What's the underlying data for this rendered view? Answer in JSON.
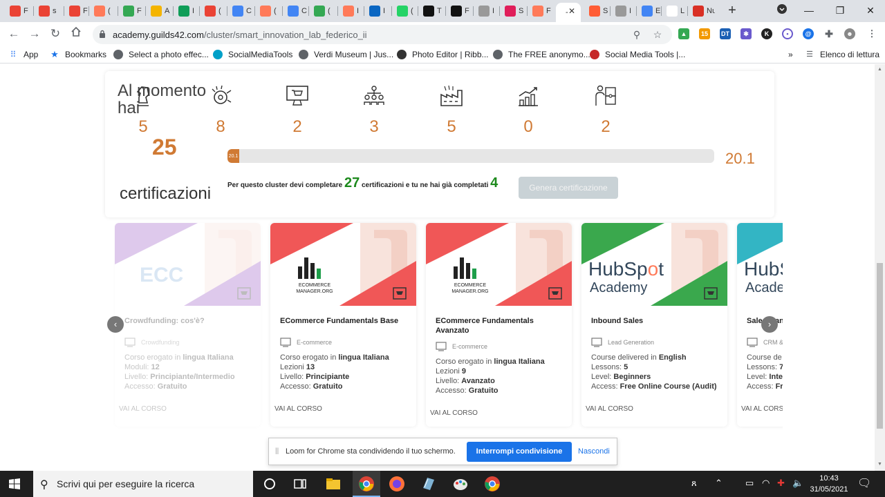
{
  "browser": {
    "tabs": [
      {
        "label": "F",
        "icon": "gmail-icon",
        "color": "#ea4335"
      },
      {
        "label": "s",
        "icon": "gmail-icon",
        "color": "#ea4335"
      },
      {
        "label": "F",
        "icon": "gmail-icon",
        "color": "#ea4335"
      },
      {
        "label": "(",
        "icon": "hubspot-icon",
        "color": "#ff7a59"
      },
      {
        "label": "F",
        "icon": "drive-icon",
        "color": "#34a853"
      },
      {
        "label": "A",
        "icon": "slides-icon",
        "color": "#f4b400"
      },
      {
        "label": "I",
        "icon": "sheets-icon",
        "color": "#0f9d58"
      },
      {
        "label": "(",
        "icon": "gmail-icon",
        "color": "#ea4335"
      },
      {
        "label": "C",
        "icon": "calendar-icon",
        "color": "#4285f4"
      },
      {
        "label": "(",
        "icon": "hubspot-icon",
        "color": "#ff7a59"
      },
      {
        "label": "C",
        "icon": "calendar-icon",
        "color": "#4285f4"
      },
      {
        "label": "(",
        "icon": "drive-icon",
        "color": "#34a853"
      },
      {
        "label": "I",
        "icon": "hubspot-icon",
        "color": "#ff7a59"
      },
      {
        "label": "I",
        "icon": "linkedin-icon",
        "color": "#0a66c2"
      },
      {
        "label": "(",
        "icon": "whatsapp-icon",
        "color": "#25d366"
      },
      {
        "label": "T",
        "icon": "circle-icon",
        "color": "#111111"
      },
      {
        "label": "F",
        "icon": "circle-icon",
        "color": "#111111"
      },
      {
        "label": "I",
        "icon": "dbox-icon",
        "color": "#999999"
      },
      {
        "label": "S",
        "icon": "slack-icon",
        "color": "#e01e5a"
      },
      {
        "label": "F",
        "icon": "hubspot-icon",
        "color": "#ff7a59"
      },
      {
        "label": "-",
        "icon": "page-icon",
        "color": "#ffffff",
        "active": true
      },
      {
        "label": "S",
        "icon": "hubspot-icon",
        "color": "#ff5c35"
      },
      {
        "label": "I",
        "icon": "dbox-icon",
        "color": "#999999"
      },
      {
        "label": "E",
        "icon": "chrome-app-icon",
        "color": "#4285f4"
      },
      {
        "label": "L",
        "icon": "page-icon",
        "color": "#ffffff"
      },
      {
        "label": "Nuo",
        "icon": "record-icon",
        "color": "#d93025"
      }
    ],
    "url_host": "academy.guilds42.com",
    "url_path": "/cluster/smart_innovation_lab_federico_ii",
    "bookmarks": [
      {
        "label": "App",
        "icon": "apps-grid-icon",
        "color": "#4285f4"
      },
      {
        "label": "Bookmarks",
        "icon": "star-icon",
        "color": "#1a73e8"
      },
      {
        "label": "Select a photo effec...",
        "icon": "globe-icon",
        "color": "#5f6368"
      },
      {
        "label": "SocialMediaTools",
        "icon": "m-logo-icon",
        "color": "#00a0c8"
      },
      {
        "label": "Verdi Museum | Jus...",
        "icon": "globe-icon",
        "color": "#5f6368"
      },
      {
        "label": "Photo Editor | Ribb...",
        "icon": "ribbet-icon",
        "color": "#333333"
      },
      {
        "label": "The FREE anonymo...",
        "icon": "globe-icon",
        "color": "#5f6368"
      },
      {
        "label": "Social Media Tools |...",
        "icon": "smt-icon",
        "color": "#c62828"
      }
    ],
    "reading_list": "Elenco di lettura",
    "more_bookmarks": "»"
  },
  "summary": {
    "heading": "Al momento hai",
    "cert_count": "25",
    "cert_word": "certificazioni",
    "stats": [
      {
        "icon": "chess-knight-icon",
        "value": "5"
      },
      {
        "icon": "brain-gear-icon",
        "value": "8"
      },
      {
        "icon": "shopping-cart-screen-icon",
        "value": "2"
      },
      {
        "icon": "team-network-icon",
        "value": "3"
      },
      {
        "icon": "factory-icon",
        "value": "5"
      },
      {
        "icon": "growth-chart-icon",
        "value": "0"
      },
      {
        "icon": "puzzle-people-icon",
        "value": "2"
      }
    ],
    "progress_label": "20.1",
    "progress_fraction": 0.201,
    "progress_value": "20.1",
    "note_prefix": "Per questo cluster devi completare",
    "note_required": "27",
    "note_middle": "certificazioni e tu ne hai già completati",
    "note_done": "4",
    "generate_button": "Genera certificazione"
  },
  "courses": [
    {
      "title": "Crowdfunding: cos'è?",
      "logo_text": "ECC",
      "category": "Crowdfunding",
      "info": [
        {
          "k": "Corso erogato ",
          "mid": "in ",
          "v": "lingua Italiana"
        },
        {
          "k": "Moduli: ",
          "v": "12"
        },
        {
          "k": "Livello: ",
          "v": "Principiante/Intermedio"
        },
        {
          "k": "Accesso: ",
          "v": "Gratuito"
        }
      ],
      "link": "VAI AL CORSO",
      "accent": "#9b59c6"
    },
    {
      "title": "ECommerce Fundamentals Base",
      "logo_text": "ECOMMERCE MANAGER.ORG",
      "category": "E-commerce",
      "info": [
        {
          "k": "Corso erogato ",
          "mid": "in ",
          "v": "lingua Italiana"
        },
        {
          "k": "Lezioni ",
          "v": "13"
        },
        {
          "k": "Livello: ",
          "v": "Principiante"
        },
        {
          "k": "Accesso: ",
          "v": "Gratuito"
        }
      ],
      "link": "VAI AL CORSO",
      "accent": "#f05757"
    },
    {
      "title": "ECommerce Fundamentals Avanzato",
      "logo_text": "ECOMMERCE MANAGER.ORG",
      "category": "E-commerce",
      "info": [
        {
          "k": "Corso erogato ",
          "mid": "in ",
          "v": "lingua Italiana"
        },
        {
          "k": "Lezioni ",
          "v": "9"
        },
        {
          "k": "Livello: ",
          "v": "Avanzato"
        },
        {
          "k": "Accesso: ",
          "v": "Gratuito"
        }
      ],
      "link": "VAI AL CORSO",
      "accent": "#f05757"
    },
    {
      "title": "Inbound Sales",
      "logo_text": "HubSpot Academy",
      "category": "Lead Generation",
      "info": [
        {
          "k": "Course delivered ",
          "mid": "in ",
          "v": "English"
        },
        {
          "k": "Lessons: ",
          "v": "5"
        },
        {
          "k": "Level: ",
          "v": "Beginners"
        },
        {
          "k": "Access: ",
          "v": "Free Online Course (Audit)"
        }
      ],
      "link": "VAI AL CORSO",
      "accent": "#3aa84d"
    },
    {
      "title": "Sales Mana",
      "logo_text": "HubSpot Academy",
      "category": "CRM &",
      "info": [
        {
          "k": "Course de",
          "v": ""
        },
        {
          "k": "Lessons: ",
          "v": "7"
        },
        {
          "k": "Level: ",
          "v": "Inte"
        },
        {
          "k": "Access: ",
          "v": "Fr"
        }
      ],
      "link": "VAI AL CORS",
      "accent": "#33b5c4"
    }
  ],
  "loom": {
    "message": "Loom for Chrome sta condividendo il tuo schermo.",
    "stop_button": "Interrompi condivisione",
    "hide_link": "Nascondi"
  },
  "taskbar": {
    "search_placeholder": "Scrivi qui per eseguire la ricerca",
    "time": "10:43",
    "date": "31/05/2021"
  },
  "colors": {
    "accent_orange": "#d07a34",
    "green_number": "#1d8a1d",
    "loom_blue": "#1a73e8"
  }
}
